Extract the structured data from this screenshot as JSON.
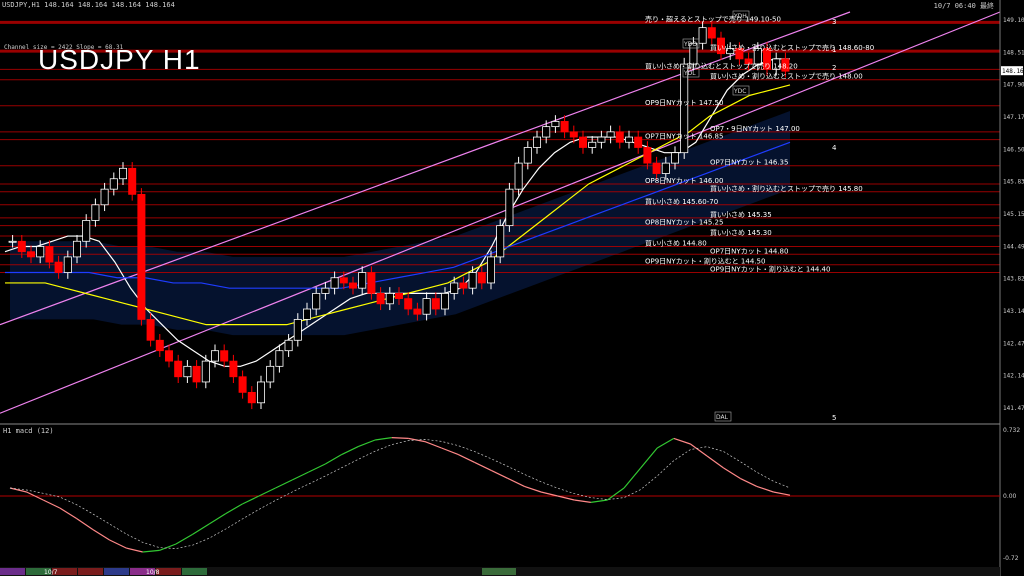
{
  "header": {
    "symbol_line": "USDJPY,H1  148.164 148.164 148.164 148.164",
    "title": "USDJPY H1",
    "channel_info": "Channel size = 2422 Slope = 68.31",
    "time_right": "10/7 06:40 最終"
  },
  "indicator": {
    "label": "H1  macd (12)",
    "max_label": "0.732",
    "min_label": "-0.72",
    "zero_label": "0.00"
  },
  "price_tags": {
    "current": "148.164",
    "axis_top": "149.100"
  },
  "colors": {
    "bg": "#000000",
    "up": "#ffffff",
    "down": "#ff0000",
    "channel": "#ee82ee",
    "ma_fast": "#ffffff",
    "ma_mid": "#ffff00",
    "ma_slow": "#1e3cff",
    "level": "#b40000",
    "cloud_blue": "#1e64ff",
    "cloud_yellow": "#c8a032",
    "macd": "#32c832",
    "macd_neg": "#ff8888"
  },
  "chart_data": {
    "type": "candlestick",
    "title": "USDJPY H1",
    "ylim": [
      141.47,
      149.3
    ],
    "y_ticks": [
      "149.100",
      "148.510",
      "147.900",
      "147.170",
      "146.500",
      "145.830",
      "145.150",
      "144.490",
      "143.820",
      "143.140",
      "142.470",
      "142.140",
      "141.470"
    ],
    "x_axis_labels": [
      "10/7",
      "10/8"
    ],
    "ohlc_closes": [
      144.9,
      144.7,
      144.6,
      144.8,
      144.5,
      144.3,
      144.6,
      144.9,
      145.3,
      145.6,
      145.9,
      146.1,
      146.3,
      145.8,
      143.4,
      143.0,
      142.8,
      142.6,
      142.3,
      142.5,
      142.2,
      142.6,
      142.8,
      142.6,
      142.3,
      142.0,
      141.8,
      142.2,
      142.5,
      142.8,
      143.0,
      143.4,
      143.6,
      143.9,
      144.0,
      144.2,
      144.1,
      144.0,
      144.3,
      143.9,
      143.7,
      143.9,
      143.8,
      143.6,
      143.5,
      143.8,
      143.6,
      143.9,
      144.1,
      144.0,
      144.3,
      144.1,
      144.6,
      145.2,
      145.9,
      146.4,
      146.7,
      146.9,
      147.1,
      147.2,
      147.0,
      146.9,
      146.7,
      146.8,
      146.9,
      147.0,
      146.8,
      146.9,
      146.7,
      146.4,
      146.2,
      146.4,
      146.6,
      148.3,
      148.7,
      149.0,
      148.8,
      148.5,
      148.6,
      148.4,
      148.3,
      148.6,
      148.2,
      148.4,
      148.164
    ],
    "ma_fast": [
      144.7,
      144.8,
      144.8,
      144.9,
      145.0,
      145.0,
      144.9,
      144.5,
      144.0,
      143.6,
      143.3,
      143.0,
      142.8,
      142.6,
      142.5,
      142.5,
      142.6,
      142.8,
      143.0,
      143.2,
      143.4,
      143.6,
      143.8,
      143.9,
      143.9,
      143.9,
      143.9,
      143.9,
      143.9,
      144.0,
      144.3,
      144.8,
      145.4,
      145.9,
      146.3,
      146.6,
      146.8,
      146.9,
      146.9,
      146.9,
      146.8,
      146.7,
      146.6,
      146.6,
      146.8,
      147.3,
      147.8,
      148.1,
      148.3,
      148.4,
      148.4
    ],
    "ma_mid": [
      144.1,
      144.1,
      144.1,
      144.0,
      143.9,
      143.8,
      143.7,
      143.6,
      143.5,
      143.4,
      143.3,
      143.3,
      143.3,
      143.3,
      143.3,
      143.4,
      143.5,
      143.6,
      143.7,
      143.8,
      143.9,
      144.0,
      144.1,
      144.3,
      144.5,
      144.8,
      145.1,
      145.4,
      145.7,
      146.0,
      146.2,
      146.4,
      146.6,
      146.8,
      147.0,
      147.3,
      147.5,
      147.7,
      147.8,
      147.9
    ],
    "ma_slow": [
      144.3,
      144.3,
      144.3,
      144.3,
      144.2,
      144.2,
      144.1,
      144.1,
      144.0,
      144.0,
      144.0,
      144.0,
      144.0,
      144.1,
      144.2,
      144.3,
      144.4,
      144.6,
      144.8,
      145.0,
      145.2,
      145.4,
      145.6,
      145.8,
      146.0,
      146.2,
      146.4,
      146.6,
      146.8
    ],
    "channel": {
      "lower_start": [
        141.6,
        0
      ],
      "lower_end": [
        149.3,
        1
      ],
      "upper_start": [
        143.3,
        0
      ],
      "upper_end": [
        149.3,
        0.85
      ]
    },
    "levels": [
      {
        "price": 149.1,
        "label": "売り・超えるとストップで売り 149.10-50"
      },
      {
        "price": 148.55,
        "label": "買い小さめ・割り込むとストップで売り 148.60-80"
      },
      {
        "price": 148.2,
        "label": "買い小さめ・割り込むとストップで売り 148.20"
      },
      {
        "price": 148.0,
        "label": "買い小さめ・割り込むとストップで売り 148.00"
      },
      {
        "price": 147.5,
        "label": "OP9日NYカット 147.50"
      },
      {
        "price": 147.0,
        "label": "OP7・9日NYカット 147.00"
      },
      {
        "price": 146.85,
        "label": "OP7日NYカット 146.85"
      },
      {
        "price": 146.35,
        "label": "OP7日NYカット 146.35"
      },
      {
        "price": 146.0,
        "label": "OP8日NYカット 146.00"
      },
      {
        "price": 145.85,
        "label": "買い小さめ・割り込むとストップで売り 145.80"
      },
      {
        "price": 145.6,
        "label": "買い小さめ 145.60-70"
      },
      {
        "price": 145.35,
        "label": "買い小さめ 145.35"
      },
      {
        "price": 145.2,
        "label": "OP8日NYカット 145.25"
      },
      {
        "price": 145.0,
        "label": "買い小さめ 145.30"
      },
      {
        "price": 144.8,
        "label": "買い小さめ 144.80"
      },
      {
        "price": 144.65,
        "label": "OP7日NYカット 144.80"
      },
      {
        "price": 144.45,
        "label": "OP9日NYカット・割り込むと 144.50"
      },
      {
        "price": 144.3,
        "label": "OP9日NYカット・割り込むと 144.40"
      }
    ],
    "tags": [
      "YDH",
      "YDO",
      "YDC",
      "YDL",
      "DAL"
    ],
    "markers": [
      "1",
      "2",
      "3",
      "4",
      "5"
    ],
    "macd": [
      0.1,
      0.05,
      -0.05,
      -0.15,
      -0.28,
      -0.42,
      -0.55,
      -0.65,
      -0.7,
      -0.68,
      -0.6,
      -0.48,
      -0.35,
      -0.22,
      -0.1,
      0.0,
      0.1,
      0.2,
      0.3,
      0.4,
      0.52,
      0.62,
      0.7,
      0.73,
      0.72,
      0.68,
      0.6,
      0.52,
      0.42,
      0.32,
      0.22,
      0.12,
      0.05,
      0.0,
      -0.05,
      -0.08,
      -0.05,
      0.1,
      0.35,
      0.6,
      0.72,
      0.65,
      0.5,
      0.35,
      0.22,
      0.12,
      0.05,
      0.01
    ]
  }
}
